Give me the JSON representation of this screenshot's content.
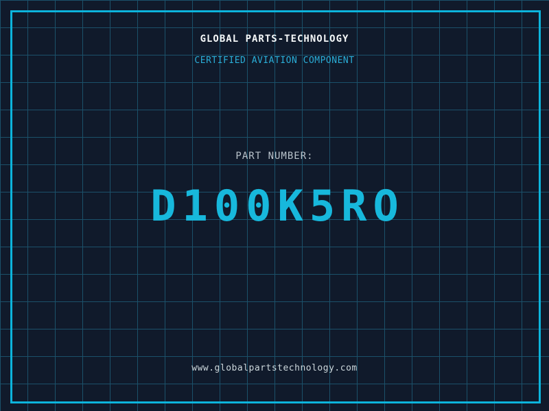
{
  "colors": {
    "background": "#101a2b",
    "grid_line": "#1b516a",
    "frame_border": "#0cb4dc",
    "title_color": "#f4f7f8",
    "subtitle_color": "#2aaed8",
    "label_color": "#b9c3cb",
    "part_number_color": "#17b8dc",
    "footer_color": "#ccd7db"
  },
  "header": {
    "title": "GLOBAL PARTS-TECHNOLOGY",
    "subtitle": "CERTIFIED AVIATION COMPONENT"
  },
  "main": {
    "label": "PART NUMBER:",
    "part_number": "D100K5RO"
  },
  "footer": {
    "website": "www.globalpartstechnology.com"
  }
}
